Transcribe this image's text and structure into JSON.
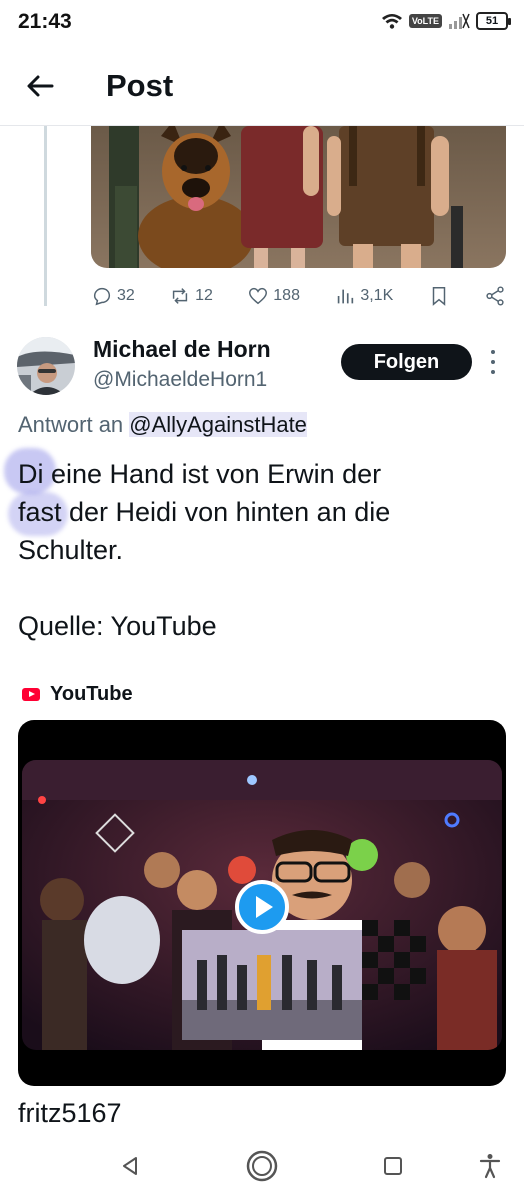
{
  "status_bar": {
    "time": "21:43",
    "network_label": "VoLTE",
    "battery": "51"
  },
  "header": {
    "title": "Post",
    "back_icon": "arrow-left-icon"
  },
  "previous_post": {
    "image_alt": "German shepherd dog with children in traditional clothing",
    "stats": {
      "replies": "32",
      "reposts": "12",
      "likes": "188",
      "views": "3,1K"
    }
  },
  "reply": {
    "author_name": "Michael de Horn",
    "author_handle": "@MichaeldeHorn1",
    "follow_label": "Folgen",
    "reply_to_prefix": "Antwort an ",
    "reply_to_handle": "@AllyAgainstHate",
    "text": "Di eine Hand ist von Erwin der\nfast der Heidi von hinten an die\nSchulter.\n\nQuelle: YouTube",
    "card": {
      "source": "YouTube"
    }
  },
  "next_post": {
    "author_name": "fritz5167"
  },
  "colors": {
    "accent": "#1d9bf0",
    "youtube_red": "#ff0033",
    "text_primary": "#0f1419",
    "text_secondary": "#536471"
  },
  "nav": {
    "back_icon": "triangle-back-icon",
    "home_icon": "circle-home-icon",
    "recents_icon": "square-recents-icon",
    "accessibility_icon": "accessibility-icon"
  }
}
